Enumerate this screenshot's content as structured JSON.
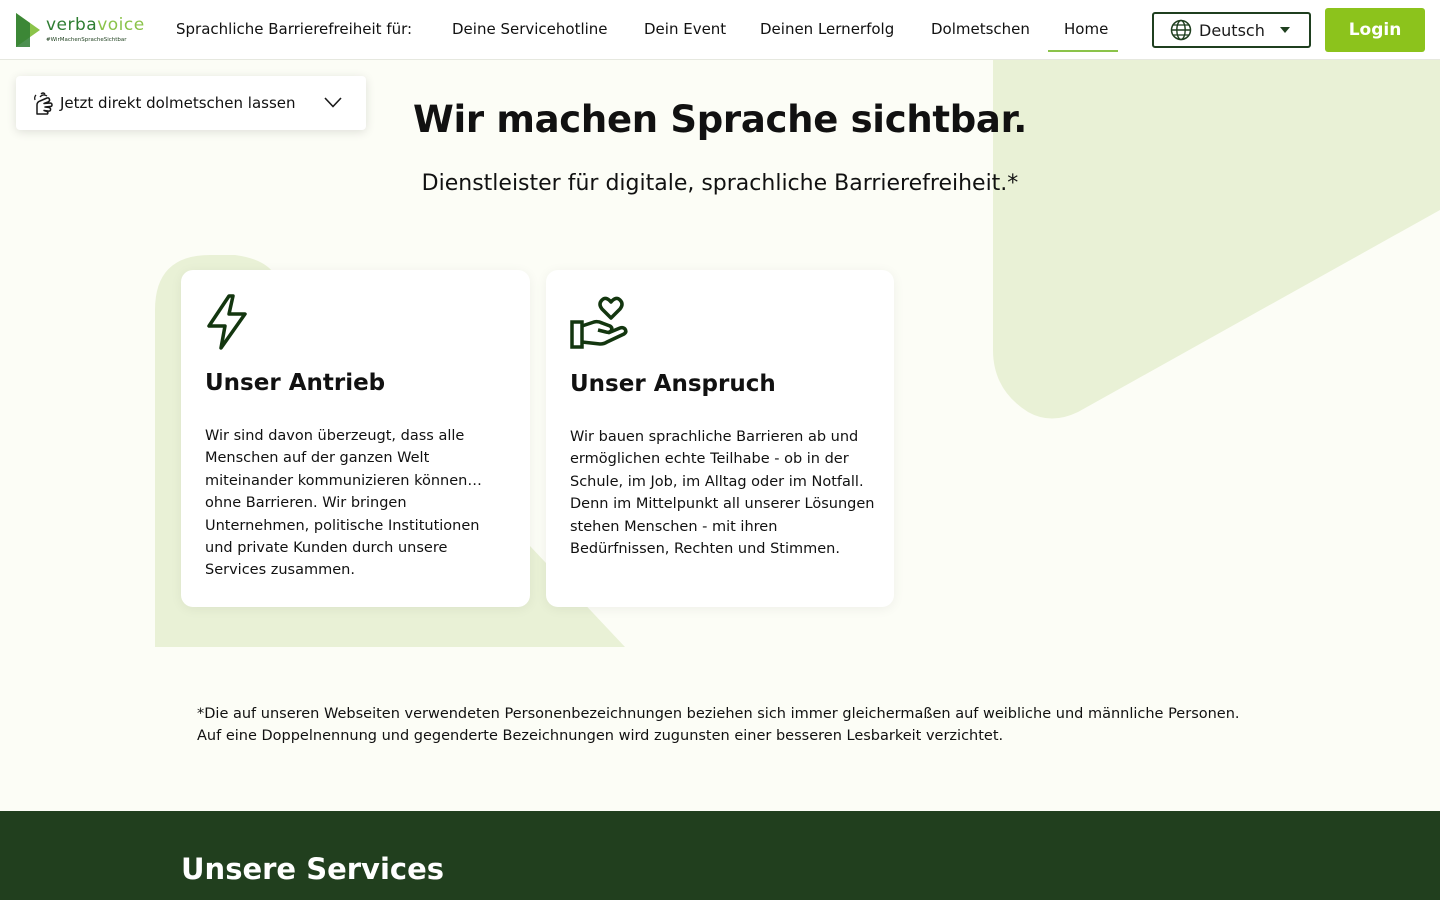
{
  "header": {
    "logo": {
      "word_part1": "verba",
      "word_part2": "voice",
      "tagline": "#WirMachenSpracheSichtbar"
    },
    "nav_intro": "Sprachliche Barrierefreiheit für:",
    "nav_items": [
      {
        "label": "Deine Servicehotline"
      },
      {
        "label": "Dein Event"
      },
      {
        "label": "Deinen Lernerfolg"
      },
      {
        "label": "Dolmetschen"
      },
      {
        "label": "Home",
        "active": true
      }
    ],
    "language": {
      "selected": "Deutsch",
      "icon": "globe-icon"
    },
    "login_label": "Login"
  },
  "direct_interpret": {
    "label": "Jetzt direkt dolmetschen lassen",
    "icon": "sign-language-icon"
  },
  "hero": {
    "title": "Wir machen Sprache sichtbar.",
    "subtitle": "Dienstleister für digitale, sprachliche Barrierefreiheit.*"
  },
  "cards": [
    {
      "icon": "lightning-icon",
      "title": "Unser Antrieb",
      "text": "Wir sind davon überzeugt, dass alle Menschen auf der ganzen Welt miteinander kommunizieren können… ohne Barrieren. Wir bringen Unternehmen, politische Institutionen und private Kunden durch unsere Services zusammen."
    },
    {
      "icon": "heart-hand-icon",
      "title": "Unser Anspruch",
      "text": "Wir bauen sprachliche Barrieren ab und ermöglichen echte Teilhabe - ob in der Schule, im Job, im Alltag oder im Notfall. Denn im Mittelpunkt all unserer Lösungen stehen Menschen - mit ihren Bedürfnissen, Rechten und Stimmen."
    }
  ],
  "footnote": "*Die auf unseren Webseiten verwendeten Personenbezeichnungen beziehen sich immer gleichermaßen auf weibliche und männliche Personen. Auf eine Doppelnennung und gegenderte Bezeichnungen wird zugunsten einer besseren Lesbarkeit verzichtet.",
  "services": {
    "title": "Unsere Services"
  },
  "colors": {
    "brand_green": "#8cc31c",
    "dark_green": "#213f1e",
    "page_bg": "#fcfdf6",
    "deco_green": "#e9f1d6"
  }
}
